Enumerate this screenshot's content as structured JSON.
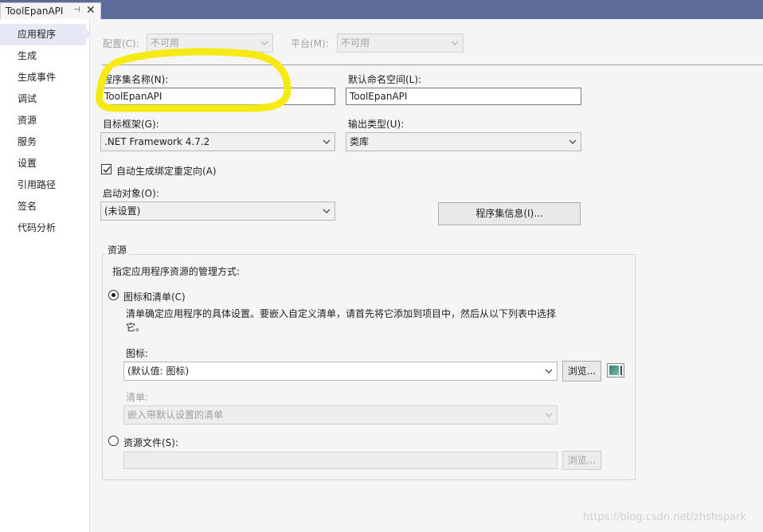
{
  "document_tab": {
    "title": "ToolEpanAPI",
    "pin_glyph": "⊣",
    "close_glyph": "✕"
  },
  "sidebar": {
    "items": [
      {
        "label": "应用程序",
        "active": true
      },
      {
        "label": "生成"
      },
      {
        "label": "生成事件"
      },
      {
        "label": "调试"
      },
      {
        "label": "资源"
      },
      {
        "label": "服务"
      },
      {
        "label": "设置"
      },
      {
        "label": "引用路径"
      },
      {
        "label": "签名"
      },
      {
        "label": "代码分析"
      }
    ]
  },
  "config": {
    "config_label": "配置(C):",
    "config_value": "不可用",
    "platform_label": "平台(M):",
    "platform_value": "不可用"
  },
  "application": {
    "assembly_name_label": "程序集名称(N):",
    "assembly_name_value": "ToolEpanAPI",
    "default_namespace_label": "默认命名空间(L):",
    "default_namespace_value": "ToolEpanAPI",
    "target_framework_label": "目标框架(G):",
    "target_framework_value": ".NET Framework 4.7.2",
    "output_type_label": "输出类型(U):",
    "output_type_value": "类库",
    "auto_binding_label": "自动生成绑定重定向(A)",
    "auto_binding_checked": true,
    "startup_object_label": "启动对象(O):",
    "startup_object_value": "(未设置)",
    "assembly_info_button": "程序集信息(I)..."
  },
  "resources": {
    "group_title": "资源",
    "instruction": "指定应用程序资源的管理方式:",
    "icon_manifest_radio_label": "图标和清单(C)",
    "icon_manifest_selected": true,
    "description": "清单确定应用程序的具体设置。要嵌入自定义清单，请首先将它添加到项目中，然后从以下列表中选择它。",
    "icon_label": "图标:",
    "icon_value": "(默认值: 图标)",
    "browse_button": "浏览...",
    "manifest_label": "清单:",
    "manifest_value": "嵌入带默认设置的清单",
    "resource_file_radio_label": "资源文件(S):",
    "resource_file_value": "",
    "resource_browse_button": "浏览..."
  },
  "annotation": {
    "highlight_color": "#f5ea14"
  },
  "watermark": "https://blog.csdn.net/zhshspark"
}
